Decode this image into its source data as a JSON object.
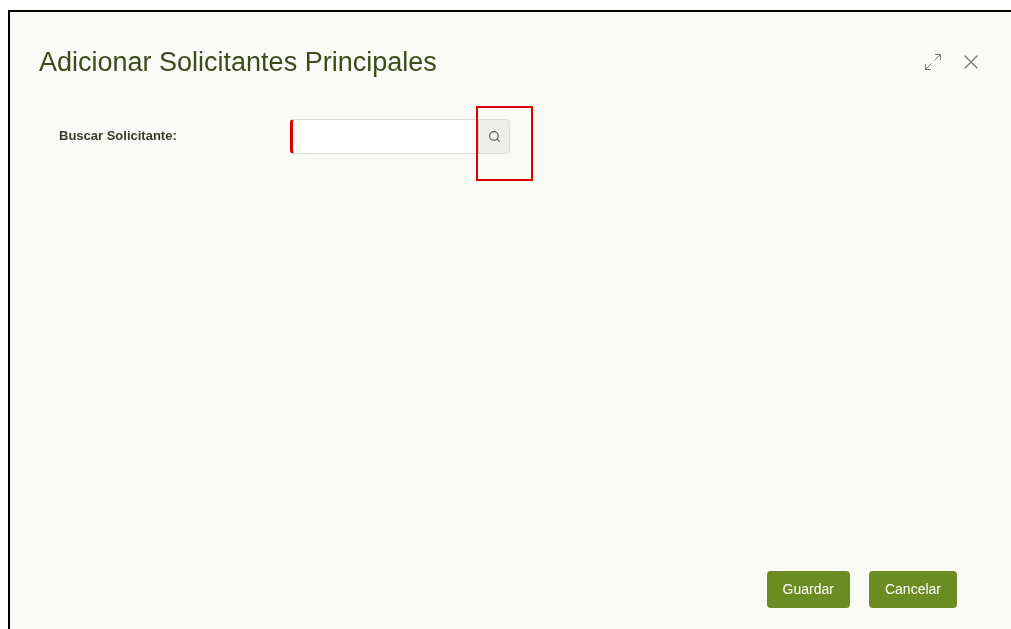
{
  "dialog": {
    "title": "Adicionar Solicitantes Principales"
  },
  "search": {
    "label": "Buscar Solicitante:",
    "invalid": true,
    "highlighted": true
  },
  "buttons": [
    {
      "label": "Guardar"
    },
    {
      "label": "Cancelar"
    }
  ]
}
